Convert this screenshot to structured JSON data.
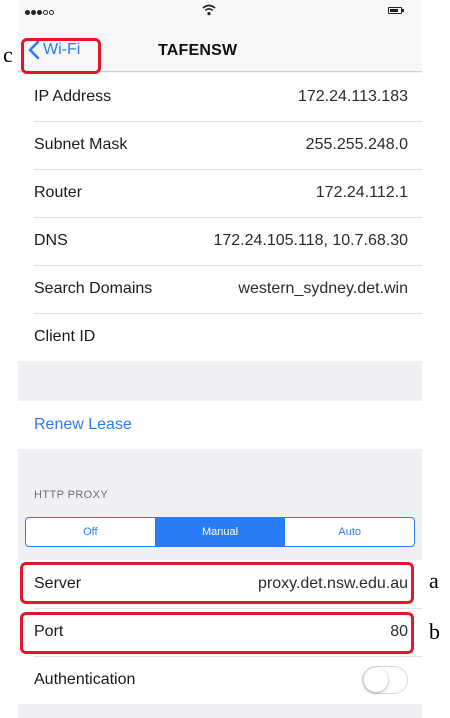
{
  "nav": {
    "back_label": "Wi-Fi",
    "title": "TAFENSW"
  },
  "status_bar": {
    "signal_icon": "signal-dots-icon",
    "wifi_icon": "wifi-icon",
    "battery_icon": "battery-icon"
  },
  "network_info": [
    {
      "label": "IP Address",
      "value": "172.24.113.183"
    },
    {
      "label": "Subnet Mask",
      "value": "255.255.248.0"
    },
    {
      "label": "Router",
      "value": "172.24.112.1"
    },
    {
      "label": "DNS",
      "value": "172.24.105.118, 10.7.68.30"
    },
    {
      "label": "Search Domains",
      "value": "western_sydney.det.win"
    },
    {
      "label": "Client ID",
      "value": ""
    }
  ],
  "renew_lease_label": "Renew Lease",
  "http_proxy": {
    "section_header": "HTTP PROXY",
    "modes": [
      "Off",
      "Manual",
      "Auto"
    ],
    "selected_mode": "Manual",
    "server_label": "Server",
    "server_value": "proxy.det.nsw.edu.au",
    "port_label": "Port",
    "port_value": "80",
    "authentication_label": "Authentication",
    "authentication_enabled": false
  },
  "annotations": {
    "a": "a",
    "b": "b",
    "c": "c"
  },
  "colors": {
    "accent": "#2a7bf6",
    "callout": "#e0182a",
    "background": "#efeff4"
  }
}
